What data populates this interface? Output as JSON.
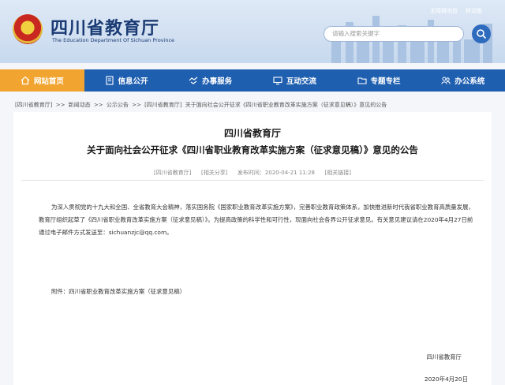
{
  "header": {
    "title": "四川省教育厅",
    "subtitle": "The Education Department Of Sichuan Province",
    "top_links": [
      "无障碍浏览",
      "移动版"
    ],
    "search_placeholder": "请输入搜索关键字"
  },
  "nav": [
    {
      "label": "网站首页",
      "icon": "home-icon",
      "active": true
    },
    {
      "label": "信息公开",
      "icon": "document-icon",
      "active": false
    },
    {
      "label": "办事服务",
      "icon": "handshake-icon",
      "active": false
    },
    {
      "label": "互动交流",
      "icon": "monitor-icon",
      "active": false
    },
    {
      "label": "专题专栏",
      "icon": "folder-icon",
      "active": false
    },
    {
      "label": "办公系统",
      "icon": "users-icon",
      "active": false
    }
  ],
  "breadcrumb": [
    "[四川省教育厅]",
    ">>",
    "新闻动态",
    ">>",
    "公示公告",
    ">>",
    "[四川省教育厅]",
    "关于面向社会公开征求《四川省职业教育改革实施方案（征求意见稿）》意见的公告"
  ],
  "article": {
    "org_line": "四川省教育厅",
    "title_line": "关于面向社会公开征求《四川省职业教育改革实施方案（征求意见稿）》意见的公告",
    "meta_source": "[四川省教育厅]",
    "meta_share": "[相关分享]",
    "meta_time": "发布时间：2020-04-21 11:28",
    "meta_related": "[相关链接]",
    "body": "为深入贯彻党的十九大和全国、全省教育大会精神，落实国务院《国家职业教育改革实施方案》，完善职业教育政策体系，加快推进新时代我省职业教育高质量发展，教育厅组织起草了《四川省职业教育改革实施方案（征求意见稿）》。为提高政策的科学性和可行性，现面向社会各界公开征求意见。有关意见建议请在2020年4月27日前通过电子邮件方式发送至：sichuanzjc@qq.com。",
    "attachment": "附件：四川省职业教育改革实施方案（征求意见稿）",
    "signature_org": "四川省教育厅",
    "signature_date": "2020年4月20日"
  }
}
